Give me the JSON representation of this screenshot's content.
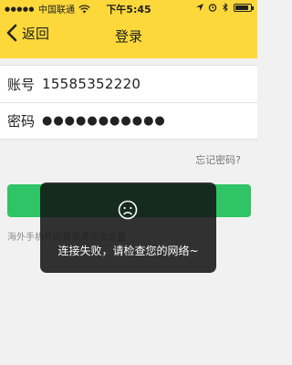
{
  "status_bar": {
    "signal_dots": "●●●●●",
    "carrier": "中国联通",
    "time": "下午5:45",
    "icons": [
      "signal-dots",
      "wifi-icon",
      "location-icon",
      "alarm-icon",
      "bluetooth-icon",
      "battery-charging-icon"
    ]
  },
  "nav": {
    "back_label": "返回",
    "title": "登录"
  },
  "form": {
    "account_label": "账号",
    "account_value": "15585352220",
    "password_label": "密码",
    "password_value": "●●●●●●●●●●●"
  },
  "forgot_password": "忘记密码?",
  "overseas_login": "海外手机号码登录请点击这里",
  "toast": {
    "icon": "sad-face-icon",
    "message": "连接失败，请检查您的网络~"
  },
  "colors": {
    "header": "#fcd83a",
    "login_button": "#2fc466",
    "toast_bg": "#111111"
  }
}
